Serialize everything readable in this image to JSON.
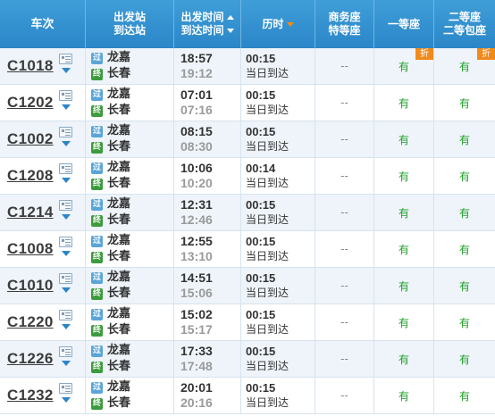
{
  "header": {
    "train": "车次",
    "depart_station": "出发站",
    "arrive_station": "到达站",
    "depart_time": "出发时间",
    "arrive_time": "到达时间",
    "duration": "历时",
    "business_seat": "商务座",
    "premium_seat": "特等座",
    "first_class": "一等座",
    "second_class": "二等座",
    "second_box": "二等包座"
  },
  "badges": {
    "pass": "过",
    "terminal": "终"
  },
  "discount_label": "折",
  "rows": [
    {
      "train": "C1018",
      "from": "龙嘉",
      "to": "长春",
      "dep": "18:57",
      "arr": "19:12",
      "dur": "00:15",
      "arrive_day": "当日到达",
      "business": "--",
      "first": "有",
      "second": "有",
      "discount": true
    },
    {
      "train": "C1202",
      "from": "龙嘉",
      "to": "长春",
      "dep": "07:01",
      "arr": "07:16",
      "dur": "00:15",
      "arrive_day": "当日到达",
      "business": "--",
      "first": "有",
      "second": "有",
      "discount": false
    },
    {
      "train": "C1002",
      "from": "龙嘉",
      "to": "长春",
      "dep": "08:15",
      "arr": "08:30",
      "dur": "00:15",
      "arrive_day": "当日到达",
      "business": "--",
      "first": "有",
      "second": "有",
      "discount": false
    },
    {
      "train": "C1208",
      "from": "龙嘉",
      "to": "长春",
      "dep": "10:06",
      "arr": "10:20",
      "dur": "00:14",
      "arrive_day": "当日到达",
      "business": "--",
      "first": "有",
      "second": "有",
      "discount": false
    },
    {
      "train": "C1214",
      "from": "龙嘉",
      "to": "长春",
      "dep": "12:31",
      "arr": "12:46",
      "dur": "00:15",
      "arrive_day": "当日到达",
      "business": "--",
      "first": "有",
      "second": "有",
      "discount": false
    },
    {
      "train": "C1008",
      "from": "龙嘉",
      "to": "长春",
      "dep": "12:55",
      "arr": "13:10",
      "dur": "00:15",
      "arrive_day": "当日到达",
      "business": "--",
      "first": "有",
      "second": "有",
      "discount": false
    },
    {
      "train": "C1010",
      "from": "龙嘉",
      "to": "长春",
      "dep": "14:51",
      "arr": "15:06",
      "dur": "00:15",
      "arrive_day": "当日到达",
      "business": "--",
      "first": "有",
      "second": "有",
      "discount": false
    },
    {
      "train": "C1220",
      "from": "龙嘉",
      "to": "长春",
      "dep": "15:02",
      "arr": "15:17",
      "dur": "00:15",
      "arrive_day": "当日到达",
      "business": "--",
      "first": "有",
      "second": "有",
      "discount": false
    },
    {
      "train": "C1226",
      "from": "龙嘉",
      "to": "长春",
      "dep": "17:33",
      "arr": "17:48",
      "dur": "00:15",
      "arrive_day": "当日到达",
      "business": "--",
      "first": "有",
      "second": "有",
      "discount": false
    },
    {
      "train": "C1232",
      "from": "龙嘉",
      "to": "长春",
      "dep": "20:01",
      "arr": "20:16",
      "dur": "00:15",
      "arrive_day": "当日到达",
      "business": "--",
      "first": "有",
      "second": "有",
      "discount": false
    }
  ]
}
